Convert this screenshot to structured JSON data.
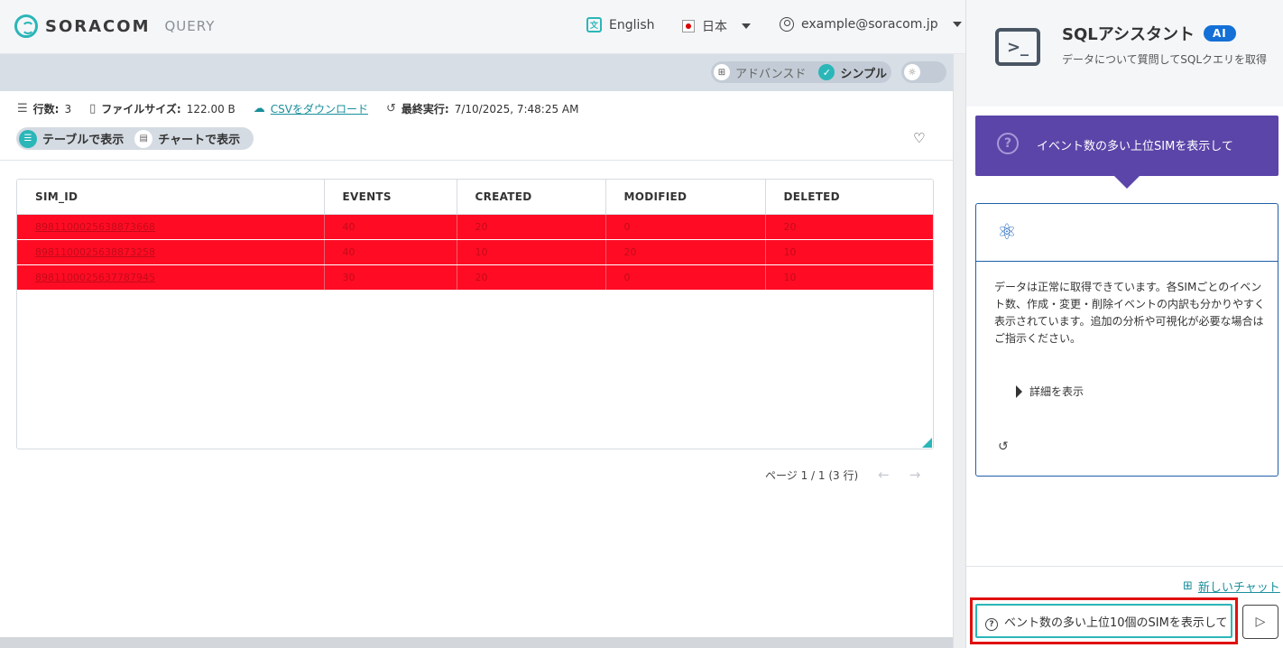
{
  "header": {
    "logo_text": "SORACOM",
    "product_label": "QUERY",
    "language_label": "English",
    "region_label": "日本",
    "account_label": "example@soracom.jp"
  },
  "mode_toggle": {
    "advanced_label": "アドバンスド",
    "simple_label": "シンプル",
    "selected": "シンプル"
  },
  "meta": {
    "rows_label": "行数:",
    "rows_value": "3",
    "filesize_label": "ファイルサイズ:",
    "filesize_value": "122.00 B",
    "csv_link": "CSVをダウンロード",
    "last_run_label": "最終実行:",
    "last_run_value": "7/10/2025, 7:48:25 AM"
  },
  "view_toggle": {
    "table_label": "テーブルで表示",
    "chart_label": "チャートで表示",
    "selected": "テーブルで表示"
  },
  "table": {
    "columns": [
      "SIM_ID",
      "EVENTS",
      "CREATED",
      "MODIFIED",
      "DELETED"
    ],
    "rows": [
      [
        "8981100025638873668",
        "40",
        "20",
        "0",
        "20"
      ],
      [
        "8981100025638873258",
        "40",
        "10",
        "20",
        "10"
      ],
      [
        "8981100025637787945",
        "30",
        "20",
        "0",
        "10"
      ]
    ]
  },
  "pager": {
    "label": "ページ 1 / 1 (3 行)"
  },
  "assistant": {
    "title": "SQLアシスタント",
    "badge": "AI",
    "subtitle": "データについて質問してSQLクエリを取得",
    "user_message": "イベント数の多い上位SIMを表示して",
    "answer_text": "データは正常に取得できています。各SIMごとのイベント数、作成・変更・削除イベントの内訳も分かりやすく表示されています。追加の分析や可視化が必要な場合はご指示ください。",
    "details_label": "詳細を表示",
    "new_chat_label": "新しいチャット",
    "input_value": "ベント数の多い上位10個のSIMを表示して"
  },
  "colors": {
    "accent": "#2bb6b8",
    "user_bubble": "#5b45a8",
    "highlight_row": "#ff0c24",
    "ai_badge": "#1470d6"
  }
}
